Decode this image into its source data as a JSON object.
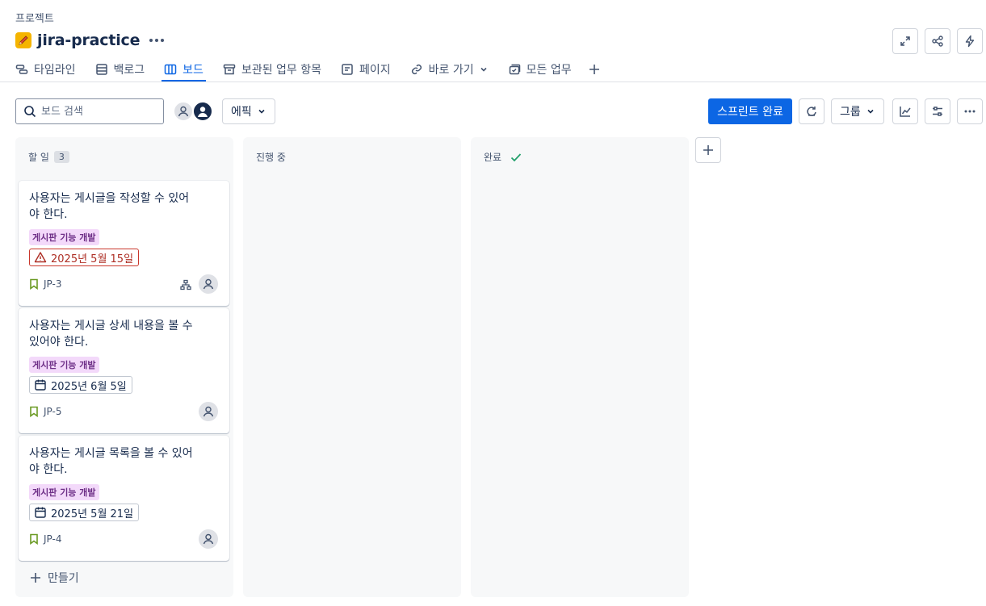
{
  "breadcrumb": "프로젝트",
  "project": {
    "name": "jira-practice",
    "icon": "pencil-icon",
    "color": "#f5b400"
  },
  "tabs": [
    {
      "label": "타임라인",
      "icon": "timeline-icon"
    },
    {
      "label": "백로그",
      "icon": "backlog-icon"
    },
    {
      "label": "보드",
      "icon": "board-icon",
      "active": true
    },
    {
      "label": "보관된 업무 항목",
      "icon": "archive-icon"
    },
    {
      "label": "페이지",
      "icon": "page-icon"
    },
    {
      "label": "바로 가기",
      "icon": "link-icon"
    },
    {
      "label": "모든 업무",
      "icon": "all-work-icon"
    }
  ],
  "toolbar": {
    "search_placeholder": "보드 검색",
    "epic_label": "에픽",
    "complete_sprint_label": "스프린트 완료",
    "group_label": "그룹"
  },
  "columns": [
    {
      "title": "할 일",
      "count": "3"
    },
    {
      "title": "진행 중"
    },
    {
      "title": "완료"
    }
  ],
  "cards": [
    {
      "title": "사용자는 게시글을 작성할 수 있어야 한다.",
      "label": "게시판 기능 개발",
      "date": "2025년 5월 15일",
      "overdue": true,
      "key": "JP-3"
    },
    {
      "title": "사용자는 게시글 상세 내용을 볼 수 있어야 한다.",
      "label": "게시판 기능 개발",
      "date": "2025년 6월 5일",
      "overdue": false,
      "key": "JP-5"
    },
    {
      "title": "사용자는 게시글 목록을 볼 수 있어야 한다.",
      "label": "게시판 기능 개발",
      "date": "2025년 5월 21일",
      "overdue": false,
      "key": "JP-4"
    }
  ],
  "create_label": "만들기",
  "colors": {
    "accent": "#0c66e4",
    "done": "#22a06b",
    "overdue": "#ae2e24",
    "label_bg": "#f3d9fa",
    "label_text": "#6e2f87"
  }
}
